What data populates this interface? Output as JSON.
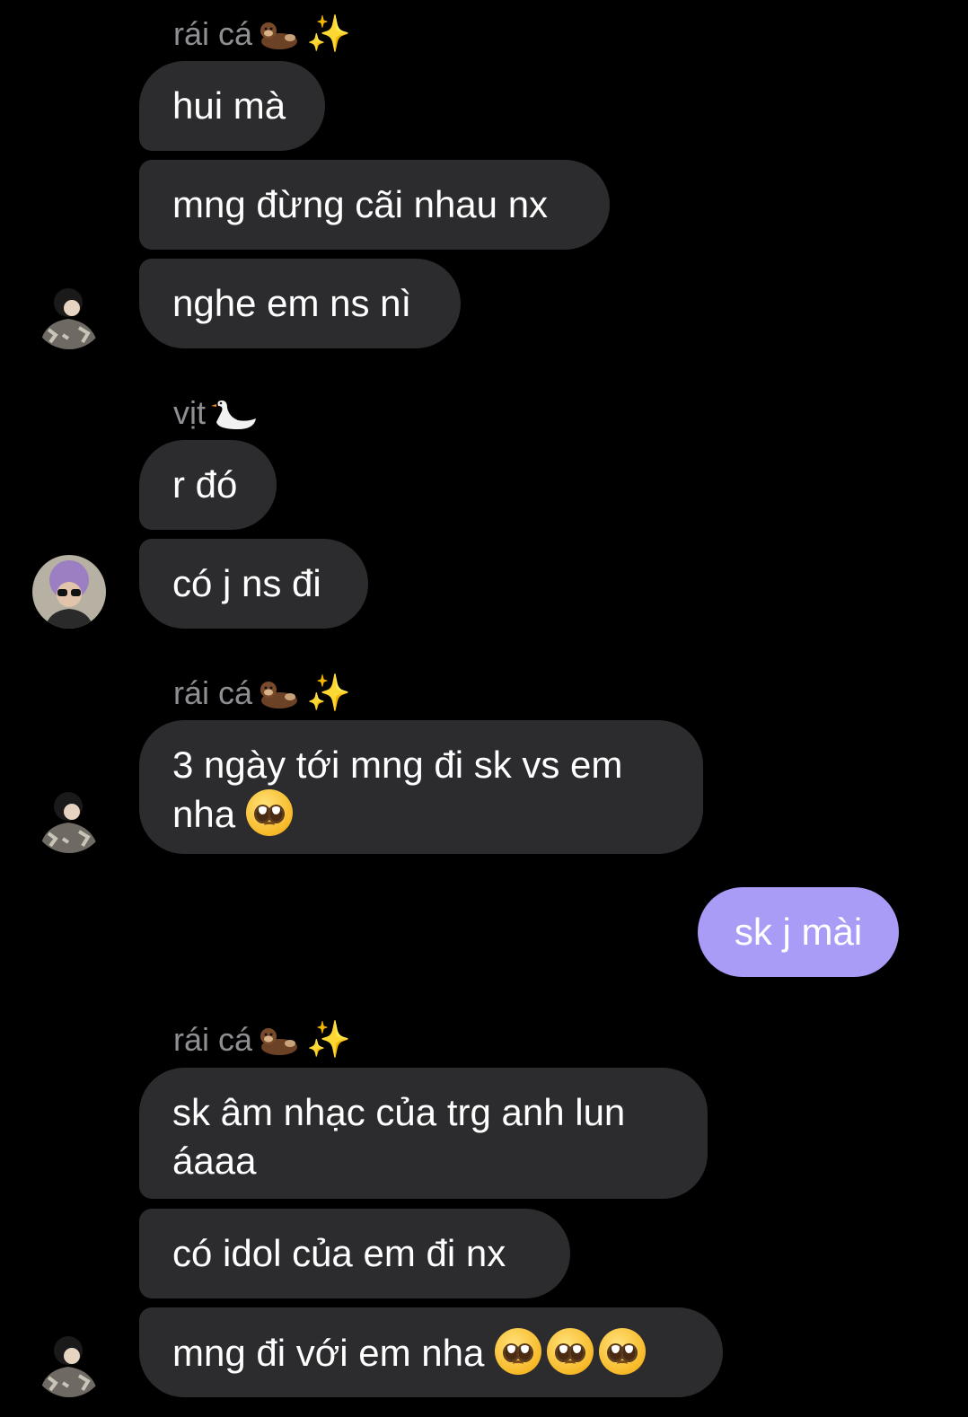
{
  "groups": [
    {
      "sender": {
        "name": "rái cá",
        "badges": [
          "otter-emoji",
          "sparkles-emoji"
        ]
      },
      "messages": [
        "hui mà",
        "mng đừng cãi nhau nx",
        "nghe em ns nì"
      ]
    },
    {
      "sender": {
        "name": "vịt",
        "badges": [
          "swan-emoji"
        ]
      },
      "messages": [
        "r đó",
        "có j ns đi"
      ]
    },
    {
      "sender": {
        "name": "rái cá",
        "badges": [
          "otter-emoji",
          "sparkles-emoji"
        ]
      },
      "messages": [
        "3 ngày tới mng đi sk vs em nha"
      ]
    },
    {
      "sender": {
        "name": "",
        "badges": []
      },
      "messages": [
        "sk j mài"
      ],
      "outgoing": true
    },
    {
      "sender": {
        "name": "rái cá",
        "badges": [
          "otter-emoji",
          "sparkles-emoji"
        ]
      },
      "messages": [
        "sk âm nhạc của trg anh lun áaaa",
        "có idol của em đi nx",
        "mng đi với em nha"
      ]
    }
  ],
  "colors": {
    "background": "#000000",
    "incoming_bubble": "#2c2c2e",
    "outgoing_bubble": "#a89cf7",
    "sender_name": "#8e8e93"
  },
  "sparkle_glyph": "✨"
}
